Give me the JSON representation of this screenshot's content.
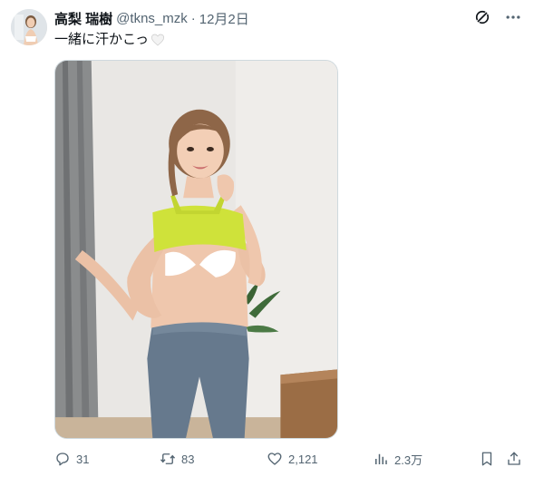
{
  "author": {
    "display_name": "高梨 瑞樹",
    "handle": "@tkns_mzk",
    "separator": "·",
    "timestamp": "12月2日",
    "avatar_icon": "avatar-photo"
  },
  "tweet": {
    "text": "一緒に汗かこっ",
    "emoji": "white-heart-icon"
  },
  "header_actions": {
    "grok_icon": "grok-icon",
    "more_icon": "more-options-icon"
  },
  "media": {
    "type": "photo"
  },
  "engagement": {
    "replies": "31",
    "reposts": "83",
    "likes": "2,121",
    "views": "2.3万"
  },
  "colors": {
    "text_primary": "#0f1419",
    "text_secondary": "#536471",
    "border": "#cfd9de"
  }
}
